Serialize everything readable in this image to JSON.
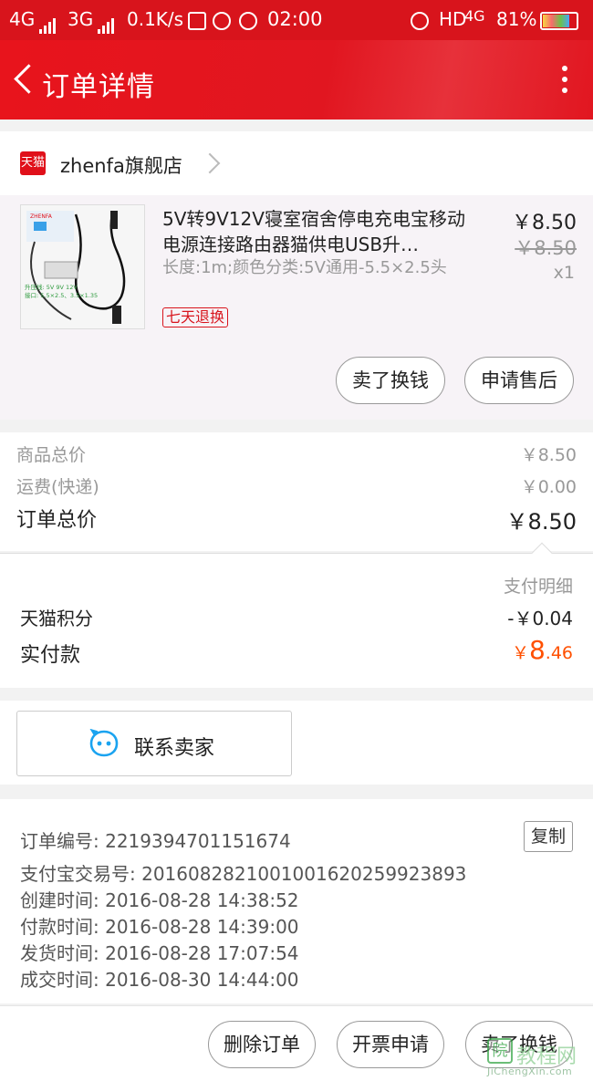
{
  "statusbar": {
    "net1": "4G",
    "net2": "3G",
    "speed": "0.1K/s",
    "time": "02:00",
    "hd": "HD",
    "net3": "4G",
    "battery": "81%",
    "battery_level": 0.81
  },
  "header": {
    "title": "订单详情",
    "menu_icon": "more-vertical-icon",
    "back_icon": "back-arrow-icon",
    "bg_color": "#e11620"
  },
  "shop": {
    "logo": "天猫",
    "name": "zhenfa旗舰店"
  },
  "item": {
    "title": "5V转9V12V寝室宿舍停电充电宝移动电源连接路由器猫供电USB升压线",
    "title_display": "5V转9V12V寝室宿舍停电充电宝移动电源连接路由器猫供电USB升…",
    "sku": "长度:1m;颜色分类:5V通用-5.5×2.5头",
    "tag": "七天退换",
    "price": "￥8.50",
    "original_price": "￥8.50",
    "quantity": "x1",
    "thumb": {
      "brand_text": "ZHENFA",
      "line1": "升压线: 5V 9V 12V",
      "line2": "接口: 5.5×2.5、3.5×1.35"
    },
    "actions": [
      "卖了换钱",
      "申请售后"
    ]
  },
  "summary": {
    "goods_label": "商品总价",
    "goods_value": "￥8.50",
    "shipping_label": "运费(快递)",
    "shipping_value": "￥0.00",
    "total_label": "订单总价",
    "total_value": "￥8.50"
  },
  "payment": {
    "detail_label": "支付明细",
    "points_label": "天猫积分",
    "points_value": "-￥0.04",
    "paid_label": "实付款",
    "paid_symbol": "￥",
    "paid_int": "8",
    "paid_dec": ".46",
    "accent_color": "#ff5000"
  },
  "contact": {
    "label": "联系卖家",
    "icon": "chat-bubble-icon",
    "icon_color": "#1aa3f0"
  },
  "info": {
    "order_no_label": "订单编号:",
    "order_no": "2219394701151674",
    "copy_label": "复制",
    "alipay_label": "支付宝交易号:",
    "alipay_no": "2016082821001001620259923893",
    "created_label": "创建时间:",
    "created": "2016-08-28 14:38:52",
    "paid_label": "付款时间:",
    "paid": "2016-08-28 14:39:00",
    "shipped_label": "发货时间:",
    "shipped": "2016-08-28 17:07:54",
    "completed_label": "成交时间:",
    "completed": "2016-08-30 14:44:00"
  },
  "bottom": {
    "delete": "删除订单",
    "invoice": "开票申请",
    "sell": "卖了换钱"
  },
  "watermark": {
    "icon": "院",
    "text": "教程网",
    "url": "JiChengXin.com"
  }
}
